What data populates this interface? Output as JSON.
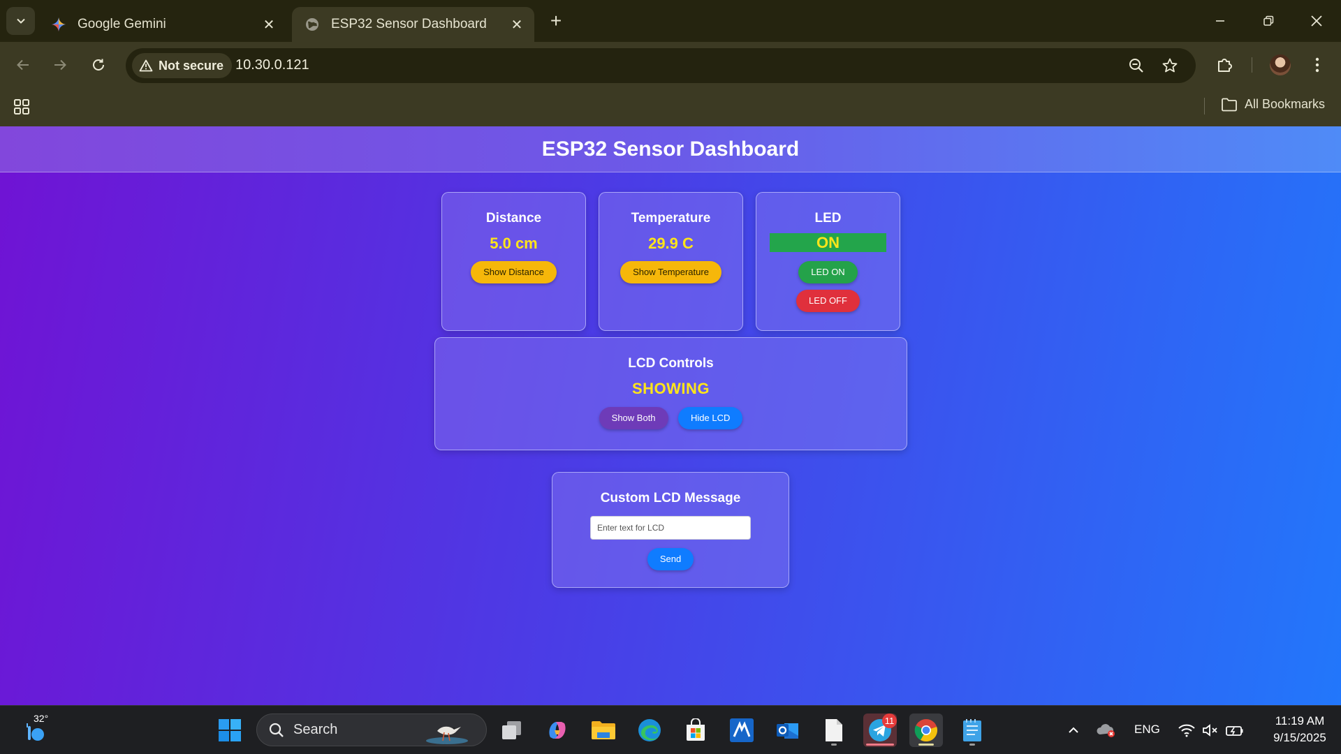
{
  "browser": {
    "tabs": [
      {
        "title": "Google Gemini",
        "active": false,
        "icon": "gemini-icon"
      },
      {
        "title": "ESP32 Sensor Dashboard",
        "active": true,
        "icon": "globe-icon"
      }
    ],
    "security_label": "Not secure",
    "url": "10.30.0.121",
    "all_bookmarks_label": "All Bookmarks"
  },
  "page": {
    "title": "ESP32 Sensor Dashboard",
    "distance": {
      "heading": "Distance",
      "value": "5.0 cm",
      "button": "Show Distance"
    },
    "temperature": {
      "heading": "Temperature",
      "value": "29.9 C",
      "button": "Show Temperature"
    },
    "led": {
      "heading": "LED",
      "status": "ON",
      "on_button": "LED ON",
      "off_button": "LED OFF"
    },
    "lcd": {
      "heading": "LCD Controls",
      "status": "SHOWING",
      "show_both_button": "Show Both",
      "hide_button": "Hide LCD"
    },
    "message": {
      "heading": "Custom LCD Message",
      "placeholder": "Enter text for LCD",
      "value": "",
      "send_button": "Send"
    }
  },
  "taskbar": {
    "weather_temp": "32°",
    "search_label": "Search",
    "telegram_badge": "11",
    "language": "ENG",
    "time": "11:19 AM",
    "date": "9/15/2025"
  },
  "colors": {
    "accent_yellow": "#ffe51a",
    "led_on_green": "#24a24a",
    "led_off_red": "#e0303c",
    "send_blue": "#0f7cff"
  }
}
